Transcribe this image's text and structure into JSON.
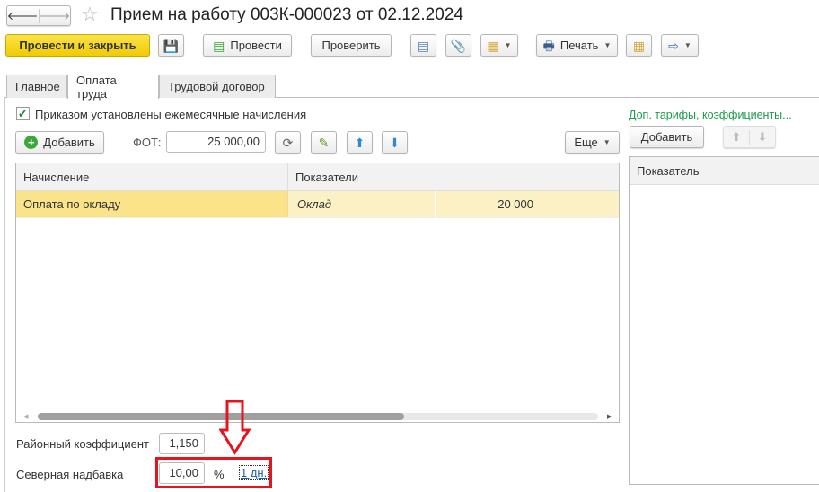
{
  "title": "Прием на работу 003К-000023 от 02.12.2024",
  "toolbar": {
    "post_close": "Провести и закрыть",
    "post": "Провести",
    "check": "Проверить",
    "print": "Печать"
  },
  "tabs": [
    {
      "label": "Главное"
    },
    {
      "label": "Оплата труда"
    },
    {
      "label": "Трудовой договор"
    }
  ],
  "main": {
    "checkbox_label": "Приказом установлены ежемесячные начисления",
    "add_label": "Добавить",
    "fot_label": "ФОТ:",
    "fot_value": "25 000,00",
    "more_label": "Еще",
    "table": {
      "headers": [
        "Начисление",
        "Показатели"
      ],
      "rows": [
        {
          "name": "Оплата по окладу",
          "indicator": "Оклад",
          "value": "20 000"
        }
      ]
    },
    "district_label": "Районный коэффициент",
    "district_value": "1,150",
    "north_label": "Северная надбавка",
    "north_value": "10,00",
    "north_unit": "%",
    "north_link": "1 дн."
  },
  "side": {
    "title": "Доп. тарифы, коэффициенты...",
    "add_label": "Добавить",
    "header": "Показатель"
  },
  "colors": {
    "accent": "#f5d800",
    "row": "#fbe38a",
    "link_green": "#1a9b4b",
    "annotation": "#e5141d"
  }
}
